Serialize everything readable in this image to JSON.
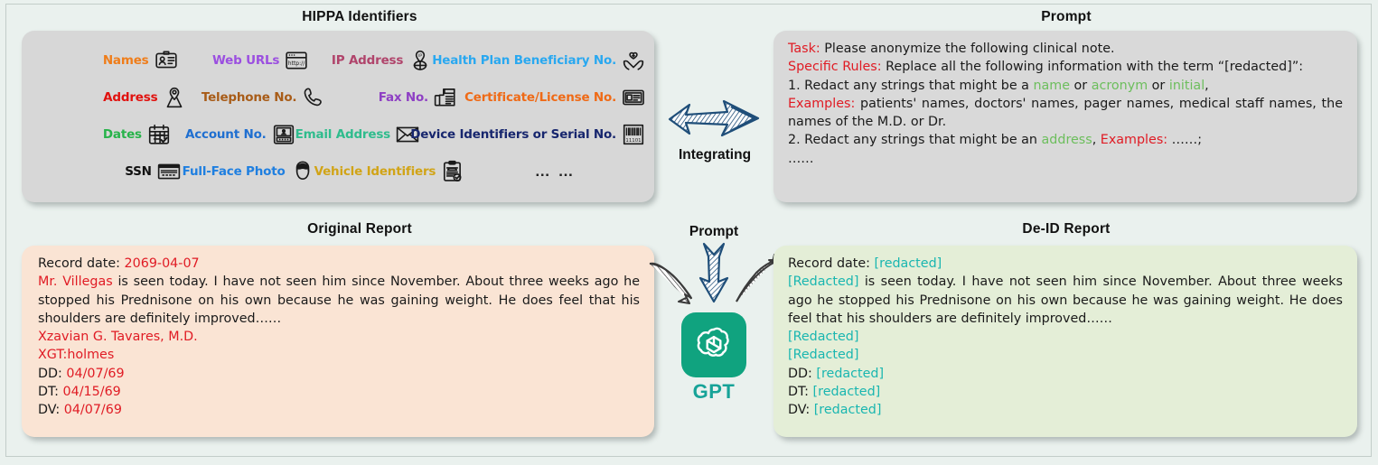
{
  "figure": {
    "background_color": "#eaf1ee",
    "titles": {
      "hippa": "HIPPA Identifiers",
      "prompt": "Prompt",
      "original": "Original Report",
      "deid": "De-ID Report"
    }
  },
  "hippa": {
    "panel_color": "#d7d7d7",
    "rows": [
      [
        {
          "label": "Names",
          "color": "#ef7d1a",
          "icon": "id-card-icon"
        },
        {
          "label": "Web URLs",
          "color": "#9b4fe0",
          "icon": "browser-window-icon"
        },
        {
          "label": "IP Address",
          "color": "#b0446b",
          "icon": "ip-location-pin-icon"
        },
        {
          "label": "Health Plan Beneficiary No.",
          "color": "#29a8f0",
          "icon": "heart-in-hands-icon"
        }
      ],
      [
        {
          "label": "Address",
          "color": "#e1120f",
          "icon": "map-pin-icon"
        },
        {
          "label": "Telephone No.",
          "color": "#a85c18",
          "icon": "phone-handset-icon"
        },
        {
          "label": "Fax No.",
          "color": "#8e3fc4",
          "icon": "fax-machine-icon"
        },
        {
          "label": "Certificate/License No.",
          "color": "#ef6a16",
          "icon": "certificate-card-icon"
        }
      ],
      [
        {
          "label": "Dates",
          "color": "#27b34a",
          "icon": "calendar-check-icon"
        },
        {
          "label": "Account No.",
          "color": "#1f6fd0",
          "icon": "account-card-icon"
        },
        {
          "label": "Email Address",
          "color": "#2fbc8d",
          "icon": "envelope-icon"
        },
        {
          "label": "Device Identifiers or Serial No.",
          "color": "#17266e",
          "icon": "barcode-icon"
        }
      ],
      [
        {
          "label": "SSN",
          "color": "#111111",
          "icon": "ssn-card-icon"
        },
        {
          "label": "Full-Face Photo",
          "color": "#1f7fe0",
          "icon": "face-portrait-icon"
        },
        {
          "label": "Vehicle Identifiers",
          "color": "#d1a417",
          "icon": "vehicle-clipboard-icon"
        },
        {
          "label": "… …",
          "color": "#222222",
          "icon": "ellipsis-icon"
        }
      ]
    ]
  },
  "integrating": {
    "label": "Integrating",
    "icon": "right-arrow-icon",
    "arrow_color": "#1f4e79"
  },
  "prompt": {
    "panel_color": "#d9d9d9",
    "lines": [
      {
        "id": "task",
        "segments": [
          {
            "text": "Task:",
            "color": "red"
          },
          {
            "text": " Please anonymize the following clinical note.",
            "color": "black"
          }
        ]
      },
      {
        "id": "specific-rules",
        "segments": [
          {
            "text": "Specific Rules:",
            "color": "red"
          },
          {
            "text": " Replace all the following information with the term “[redacted]”:",
            "color": "black"
          }
        ]
      },
      {
        "id": "rule-1",
        "segments": [
          {
            "text": "1. Redact any strings that might be a ",
            "color": "black"
          },
          {
            "text": "name",
            "color": "green"
          },
          {
            "text": " or ",
            "color": "black"
          },
          {
            "text": "acronym",
            "color": "green"
          },
          {
            "text": " or ",
            "color": "black"
          },
          {
            "text": "initial",
            "color": "green"
          },
          {
            "text": ",",
            "color": "black"
          }
        ]
      },
      {
        "id": "examples-1",
        "segments": [
          {
            "text": "Examples:",
            "color": "red"
          },
          {
            "text": " patients' names, doctors' names, pager names, medical staff names, the names of the M.D. or Dr.",
            "color": "black"
          }
        ]
      },
      {
        "id": "rule-2",
        "segments": [
          {
            "text": "2. Redact any strings that might be an ",
            "color": "black"
          },
          {
            "text": "address",
            "color": "green"
          },
          {
            "text": ", ",
            "color": "black"
          },
          {
            "text": "Examples:",
            "color": "red"
          },
          {
            "text": " ……;",
            "color": "black"
          }
        ]
      },
      {
        "id": "tail",
        "segments": [
          {
            "text": "……",
            "color": "black"
          }
        ]
      }
    ]
  },
  "gpt": {
    "prompt_caption": "Prompt",
    "label": "GPT",
    "logo_icon": "openai-logo-icon",
    "logo_color": "#10a37f",
    "label_color": "#17a398",
    "arrow_down_icon": "down-arrow-icon",
    "arrow_left_icon": "curved-arrow-in-left-icon",
    "arrow_right_icon": "curved-arrow-out-right-icon"
  },
  "original_report": {
    "panel_color": "#fae4d4",
    "lines": [
      {
        "id": "record-date",
        "segments": [
          {
            "text": "Record date: ",
            "color": "black"
          },
          {
            "text": "2069-04-07",
            "color": "red"
          }
        ]
      },
      {
        "id": "narrative",
        "segments": [
          {
            "text": "Mr. Villegas",
            "color": "red"
          },
          {
            "text": " is seen today. I have not seen him since November.  About three weeks ago he stopped his Prednisone on his own because he was gaining weight. He does feel that his shoulders are definitely improved……",
            "color": "black"
          }
        ]
      },
      {
        "id": "signature",
        "segments": [
          {
            "text": "Xzavian G. Tavares, M.D.",
            "color": "red"
          }
        ]
      },
      {
        "id": "initials",
        "segments": [
          {
            "text": "XGT:holmes",
            "color": "red"
          }
        ]
      },
      {
        "id": "dd",
        "segments": [
          {
            "text": "DD: ",
            "color": "black"
          },
          {
            "text": "04/07/69",
            "color": "red"
          }
        ]
      },
      {
        "id": "dt",
        "segments": [
          {
            "text": "DT: ",
            "color": "black"
          },
          {
            "text": "04/15/69",
            "color": "red"
          }
        ]
      },
      {
        "id": "dv",
        "segments": [
          {
            "text": "DV: ",
            "color": "black"
          },
          {
            "text": "04/07/69",
            "color": "red"
          }
        ]
      }
    ]
  },
  "deid_report": {
    "panel_color": "#e4eed7",
    "lines": [
      {
        "id": "record-date",
        "segments": [
          {
            "text": "Record date: ",
            "color": "black"
          },
          {
            "text": "[redacted]",
            "color": "teal"
          }
        ]
      },
      {
        "id": "narrative",
        "segments": [
          {
            "text": "[Redacted]",
            "color": "teal"
          },
          {
            "text": " is seen today.  I have not seen him since November.  About three weeks ago he stopped his Prednisone on his own because he was gaining weight.  He does feel that his shoulders are definitely improved……",
            "color": "black"
          }
        ]
      },
      {
        "id": "signature",
        "segments": [
          {
            "text": "[Redacted]",
            "color": "teal"
          }
        ]
      },
      {
        "id": "initials",
        "segments": [
          {
            "text": "[Redacted]",
            "color": "teal"
          }
        ]
      },
      {
        "id": "dd",
        "segments": [
          {
            "text": "DD: ",
            "color": "black"
          },
          {
            "text": "[redacted]",
            "color": "teal"
          }
        ]
      },
      {
        "id": "dt",
        "segments": [
          {
            "text": "DT: ",
            "color": "black"
          },
          {
            "text": "[redacted]",
            "color": "teal"
          }
        ]
      },
      {
        "id": "dv",
        "segments": [
          {
            "text": "DV: ",
            "color": "black"
          },
          {
            "text": "[redacted]",
            "color": "teal"
          }
        ]
      }
    ]
  }
}
